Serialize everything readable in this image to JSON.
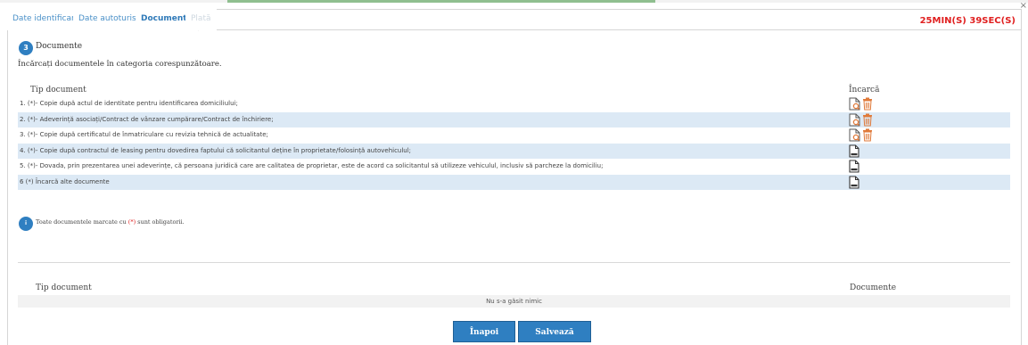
{
  "tabs": [
    {
      "label": "Date identificare",
      "state": "normal"
    },
    {
      "label": "Date autoturism",
      "state": "normal"
    },
    {
      "label": "Documente",
      "state": "active"
    },
    {
      "label": "Plată",
      "state": "disabled"
    }
  ],
  "timer": "25MIN(S) 39SEC(S)",
  "close_label": "×",
  "section": {
    "step": "3",
    "title": "Documente",
    "subtitle": "Încărcați documentele în categoria corespunzătoare."
  },
  "upload_table": {
    "col_type": "Tip document",
    "col_upload": "Încarcă",
    "rows": [
      {
        "text": "1. (*)- Copie după actul de identitate pentru identificarea domiciliului;",
        "icons": [
          "file-view-icon",
          "trash-icon"
        ]
      },
      {
        "text": "2. (*)- Adeverință asociați/Contract de vânzare cumpărare/Contract de închiriere;",
        "icons": [
          "file-view-icon",
          "trash-icon"
        ]
      },
      {
        "text": "3. (*)- Copie după certificatul de înmatriculare cu revizia tehnică de actualitate;",
        "icons": [
          "file-view-icon",
          "trash-icon"
        ]
      },
      {
        "text": "4. (*)- Copie după contractul de leasing pentru dovedirea faptului că solicitantul deține în proprietate/folosință autovehiculul;",
        "icons": [
          "file-upload-icon"
        ]
      },
      {
        "text": "5. (*)- Dovada, prin prezentarea unei adeverințe, că persoana juridică care are calitatea de proprietar, este de acord ca solicitantul să utilizeze vehiculul, inclusiv să parcheze la domiciliu;",
        "icons": [
          "file-upload-icon"
        ]
      },
      {
        "text": "6  (*) Încarcă alte documente",
        "icons": [
          "file-upload-icon"
        ]
      }
    ]
  },
  "note": {
    "badge": "i",
    "before": "Toate documentele marcate cu ",
    "marker": "(*)",
    "after": " sunt obligatorii."
  },
  "documents_table": {
    "col_type": "Tip document",
    "col_docs": "Documente",
    "empty_text": "Nu s-a găsit nimic"
  },
  "buttons": {
    "back": "Înapoi",
    "save": "Salvează"
  },
  "colors": {
    "accent": "#2f7fc1",
    "row_alt": "#dce9f5",
    "timer": "#e02020",
    "icon_orange": "#e07a3a"
  }
}
